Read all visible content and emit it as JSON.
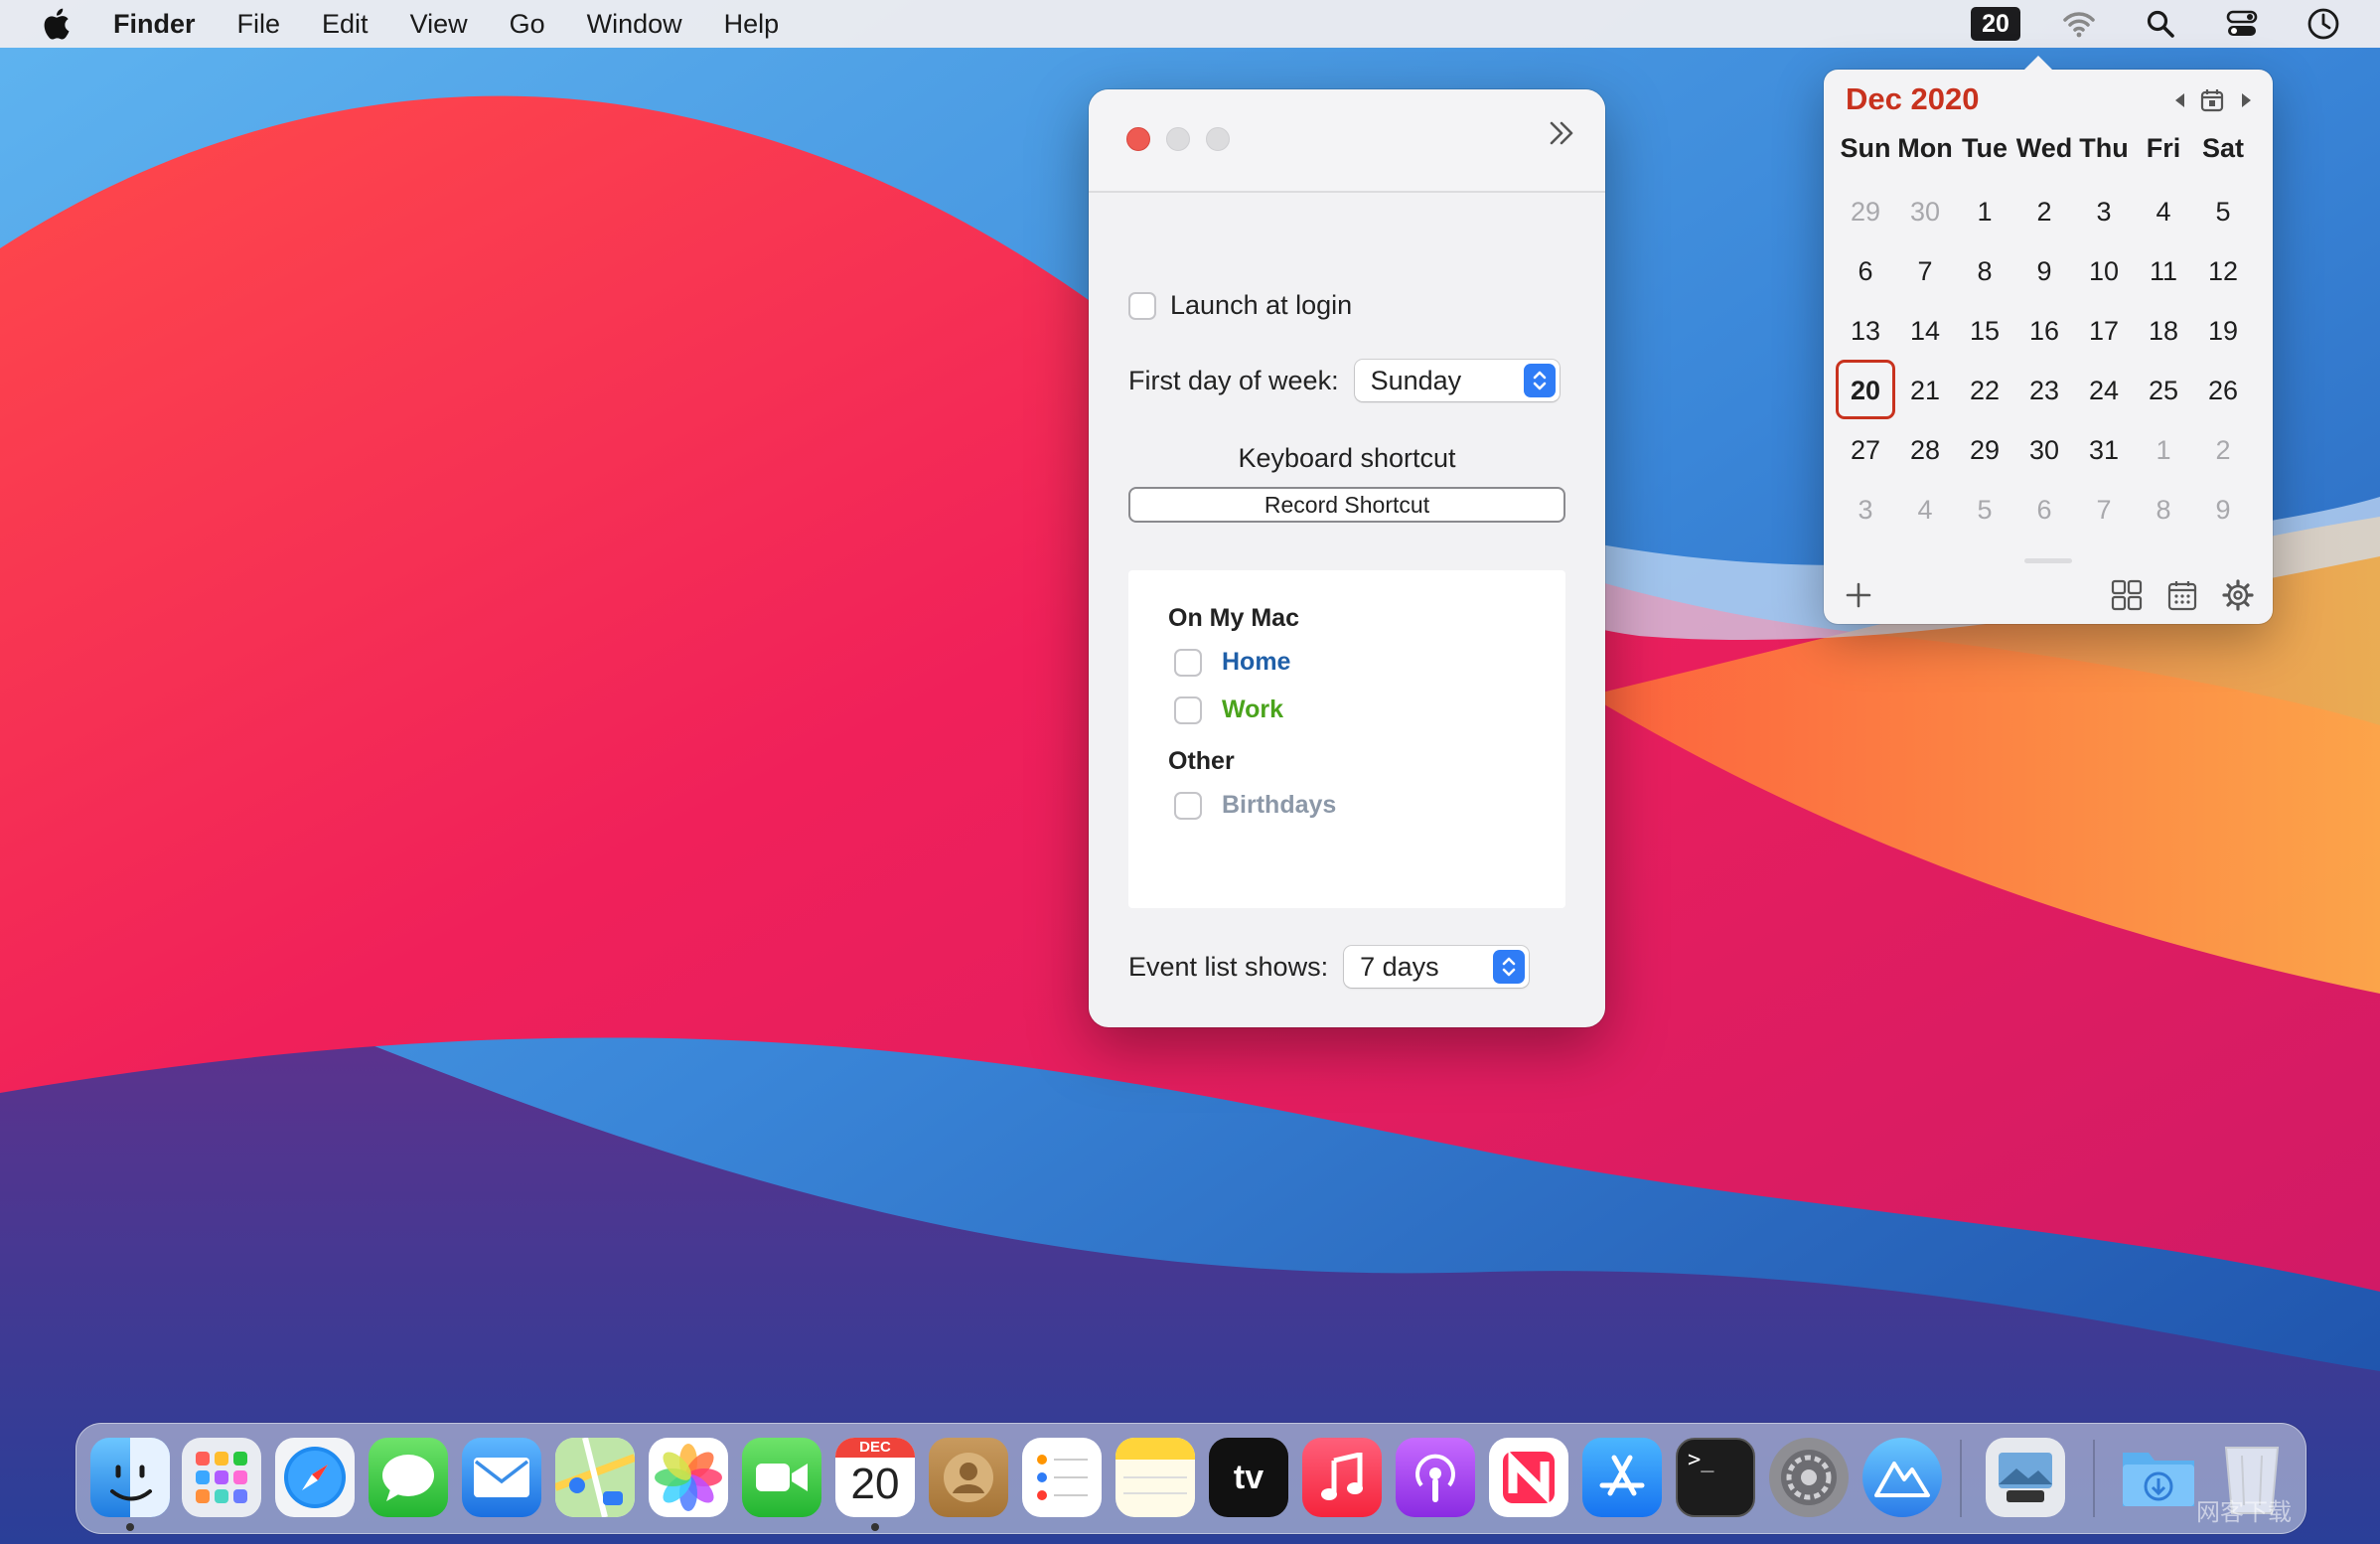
{
  "menubar": {
    "app_name": "Finder",
    "menus": [
      "File",
      "Edit",
      "View",
      "Go",
      "Window",
      "Help"
    ],
    "date_badge": "20"
  },
  "prefs": {
    "launch_at_login": "Launch at login",
    "first_day_label": "First day of week:",
    "first_day_value": "Sunday",
    "shortcut_title": "Keyboard shortcut",
    "record_button": "Record Shortcut",
    "groups": [
      {
        "name": "On My Mac",
        "calendars": [
          {
            "name": "Home",
            "color": "#1f5fa8"
          },
          {
            "name": "Work",
            "color": "#4aa31c"
          }
        ]
      },
      {
        "name": "Other",
        "calendars": [
          {
            "name": "Birthdays",
            "color": "#8c98a8"
          }
        ]
      }
    ],
    "event_list_label": "Event list shows:",
    "event_list_value": "7 days"
  },
  "calendar": {
    "title": "Dec 2020",
    "accent": "#c8321e",
    "weekdays": [
      "Sun",
      "Mon",
      "Tue",
      "Wed",
      "Thu",
      "Fri",
      "Sat"
    ],
    "weeks": [
      [
        {
          "d": "29",
          "dim": true
        },
        {
          "d": "30",
          "dim": true
        },
        {
          "d": "1"
        },
        {
          "d": "2"
        },
        {
          "d": "3"
        },
        {
          "d": "4"
        },
        {
          "d": "5"
        }
      ],
      [
        {
          "d": "6"
        },
        {
          "d": "7"
        },
        {
          "d": "8"
        },
        {
          "d": "9"
        },
        {
          "d": "10"
        },
        {
          "d": "11"
        },
        {
          "d": "12"
        }
      ],
      [
        {
          "d": "13"
        },
        {
          "d": "14"
        },
        {
          "d": "15"
        },
        {
          "d": "16"
        },
        {
          "d": "17"
        },
        {
          "d": "18"
        },
        {
          "d": "19"
        }
      ],
      [
        {
          "d": "20",
          "today": true
        },
        {
          "d": "21"
        },
        {
          "d": "22"
        },
        {
          "d": "23"
        },
        {
          "d": "24"
        },
        {
          "d": "25"
        },
        {
          "d": "26"
        }
      ],
      [
        {
          "d": "27"
        },
        {
          "d": "28"
        },
        {
          "d": "29"
        },
        {
          "d": "30"
        },
        {
          "d": "31"
        },
        {
          "d": "1",
          "dim": true
        },
        {
          "d": "2",
          "dim": true
        }
      ],
      [
        {
          "d": "3",
          "dim": true
        },
        {
          "d": "4",
          "dim": true
        },
        {
          "d": "5",
          "dim": true
        },
        {
          "d": "6",
          "dim": true
        },
        {
          "d": "7",
          "dim": true
        },
        {
          "d": "8",
          "dim": true
        },
        {
          "d": "9",
          "dim": true
        }
      ]
    ]
  },
  "dock": {
    "calendar_icon_month": "DEC",
    "calendar_icon_day": "20",
    "tv_label": "tv",
    "terminal_prompt": ">_",
    "watermark": "网客下载"
  }
}
